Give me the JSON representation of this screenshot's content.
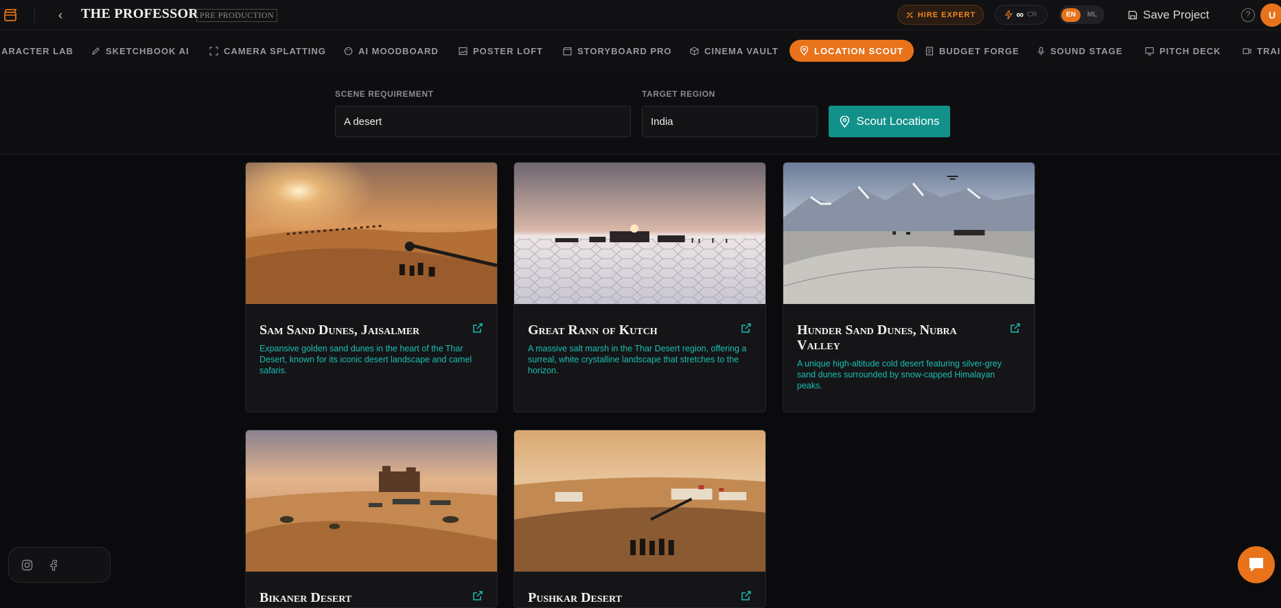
{
  "header": {
    "title": "THE PROFESSOR",
    "stage_badge": "PRE PRODUCTION",
    "hire_label": "HIRE EXPERT",
    "credits_value": "∞",
    "credits_unit": "CR",
    "lang_en": "EN",
    "lang_ml": "ML",
    "save_label": "Save Project",
    "help_glyph": "?",
    "avatar_initial": "U"
  },
  "tabs": [
    {
      "label": "ARACTER LAB",
      "icon": "character-icon"
    },
    {
      "label": "SKETCHBOOK AI",
      "icon": "pencil-icon"
    },
    {
      "label": "CAMERA SPLATTING",
      "icon": "scan-icon"
    },
    {
      "label": "AI MOODBOARD",
      "icon": "palette-icon"
    },
    {
      "label": "POSTER LOFT",
      "icon": "image-icon"
    },
    {
      "label": "STORYBOARD PRO",
      "icon": "clapboard-icon"
    },
    {
      "label": "CINEMA VAULT",
      "icon": "box-icon"
    },
    {
      "label": "LOCATION SCOUT",
      "icon": "map-pin-icon",
      "active": true
    },
    {
      "label": "BUDGET FORGE",
      "icon": "receipt-icon"
    },
    {
      "label": "SOUND STAGE",
      "icon": "mic-icon"
    },
    {
      "label": "PITCH DECK",
      "icon": "presentation-icon"
    },
    {
      "label": "TRAI",
      "icon": "video-icon"
    }
  ],
  "search": {
    "scene_label": "SCENE REQUIREMENT",
    "scene_value": "A desert",
    "region_label": "TARGET REGION",
    "region_value": "India",
    "scout_button": "Scout Locations"
  },
  "locations": [
    {
      "name": "Sam Sand Dunes, Jaisalmer",
      "description": "Expansive golden sand dunes in the heart of the Thar Desert, known for its iconic desert landscape and camel safaris."
    },
    {
      "name": "Great Rann of Kutch",
      "description": "A massive salt marsh in the Thar Desert region, offering a surreal, white crystalline landscape that stretches to the horizon."
    },
    {
      "name": "Hunder Sand Dunes, Nubra Valley",
      "description": "A unique high-altitude cold desert featuring silver-grey sand dunes surrounded by snow-capped Himalayan peaks."
    },
    {
      "name": "Bikaner Desert",
      "description": ""
    },
    {
      "name": "Pushkar Desert",
      "description": ""
    }
  ],
  "colors": {
    "accent": "#e8731b",
    "teal": "#12918a",
    "teal_text": "#19bfb1"
  }
}
